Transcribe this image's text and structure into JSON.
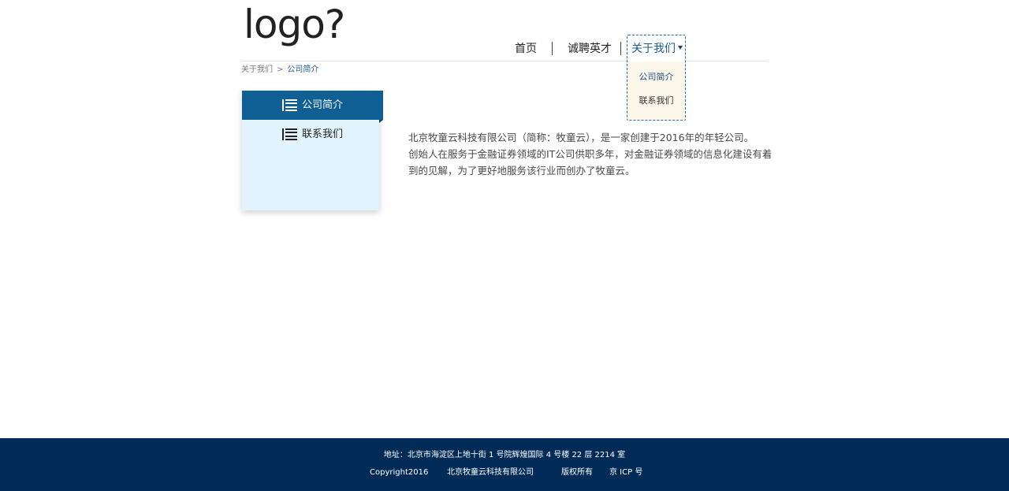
{
  "header": {
    "logo_text": "logo?",
    "nav": {
      "home": "首页",
      "careers": "诚聘英才",
      "about": "关于我们"
    },
    "dropdown": {
      "items": [
        "公司简介",
        "联系我们"
      ]
    }
  },
  "breadcrumb": {
    "parent": "关于我们",
    "separator": ">",
    "current": "公司简介"
  },
  "sidebar": {
    "items": [
      {
        "label": "公司简介",
        "active": true
      },
      {
        "label": "联系我们",
        "active": false
      }
    ]
  },
  "content": {
    "paragraphs": [
      "北京牧童云科技有限公司（简称：牧童云），是一家创建于2016年的年轻公司。",
      "创始人在服务于金融证券领域的IT公司供职多年，对金融证券领域的信息化建设有着独",
      "到的见解，为了更好地服务该行业而创办了牧童云。"
    ]
  },
  "footer": {
    "address": "地址：北京市海淀区上地十街 1 号院辉煌国际 4 号楼 22 层 2214 室",
    "copyright": "Copyright2016",
    "company": "北京牧童云科技有限公司",
    "rights": "版权所有",
    "icp": "京 ICP 号"
  },
  "colors": {
    "accent": "#0f5e94",
    "sidebar_bg": "#e1f3fc",
    "footer_bg": "#022c57",
    "dropdown_bg": "#fbf6ea"
  }
}
